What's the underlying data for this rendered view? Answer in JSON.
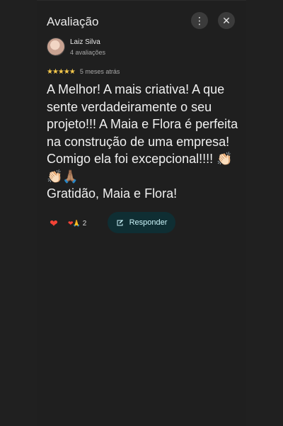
{
  "dialog": {
    "title": "Avaliação",
    "more_icon": "more-vert-icon",
    "close_icon": "close-icon"
  },
  "author": {
    "name": "Laiz Silva",
    "reviews": "4 avaliações",
    "avatar_icon": "avatar-image"
  },
  "rating": {
    "stars": "★★★★★",
    "value": 5,
    "max": 5,
    "time": "5 meses atrás"
  },
  "review": {
    "text": "A Melhor! A mais criativa! A que sente verdadeiramente o seu projeto!!! A Maia e Flora é perfeita na construção de uma empresa! Comigo ela foi excepcional!!!! 👏🏻👏🏻🙏🏽\nGratidão, Maia e Flora!"
  },
  "actions": {
    "heart": "❤",
    "reaction_icons": "❤🙏",
    "reaction_count": "2",
    "reply_label": "Responder",
    "reply_icon": "reply-edit-icon"
  },
  "colors": {
    "background": "#1f1f1f",
    "star": "#f5c84c",
    "heart": "#f44336",
    "reply_button": "#0f2e33",
    "reply_text": "#c9f3f8"
  }
}
